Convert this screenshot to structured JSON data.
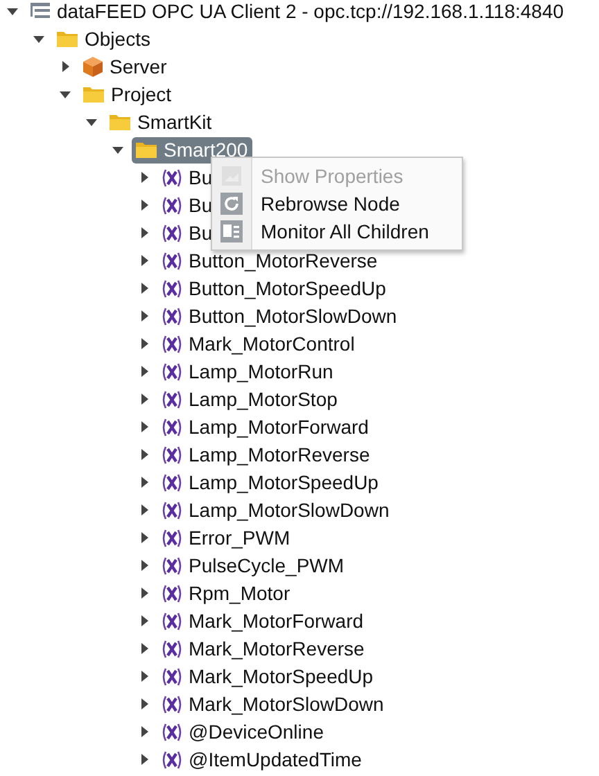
{
  "tree": [
    {
      "label": "dataFEED OPC UA Client 2 - opc.tcp://192.168.1.118:4840",
      "kind": "root",
      "expanded": true,
      "selected": false,
      "children": [
        {
          "label": "Objects",
          "kind": "folder",
          "expanded": true,
          "selected": false,
          "children": [
            {
              "label": "Server",
              "kind": "object",
              "expanded": false,
              "selected": false
            },
            {
              "label": "Project",
              "kind": "folder",
              "expanded": true,
              "selected": false,
              "children": [
                {
                  "label": "SmartKit",
                  "kind": "folder",
                  "expanded": true,
                  "selected": false,
                  "children": [
                    {
                      "label": "Smart200",
                      "kind": "folder",
                      "expanded": true,
                      "selected": true,
                      "children": [
                        {
                          "label": "Bu",
                          "kind": "variable",
                          "expanded": false,
                          "selected": false
                        },
                        {
                          "label": "Bu",
                          "kind": "variable",
                          "expanded": false,
                          "selected": false
                        },
                        {
                          "label": "Bu",
                          "kind": "variable",
                          "expanded": false,
                          "selected": false
                        },
                        {
                          "label": "Button_MotorReverse",
                          "kind": "variable",
                          "expanded": false,
                          "selected": false
                        },
                        {
                          "label": "Button_MotorSpeedUp",
                          "kind": "variable",
                          "expanded": false,
                          "selected": false
                        },
                        {
                          "label": "Button_MotorSlowDown",
                          "kind": "variable",
                          "expanded": false,
                          "selected": false
                        },
                        {
                          "label": "Mark_MotorControl",
                          "kind": "variable",
                          "expanded": false,
                          "selected": false
                        },
                        {
                          "label": "Lamp_MotorRun",
                          "kind": "variable",
                          "expanded": false,
                          "selected": false
                        },
                        {
                          "label": "Lamp_MotorStop",
                          "kind": "variable",
                          "expanded": false,
                          "selected": false
                        },
                        {
                          "label": "Lamp_MotorForward",
                          "kind": "variable",
                          "expanded": false,
                          "selected": false
                        },
                        {
                          "label": "Lamp_MotorReverse",
                          "kind": "variable",
                          "expanded": false,
                          "selected": false
                        },
                        {
                          "label": "Lamp_MotorSpeedUp",
                          "kind": "variable",
                          "expanded": false,
                          "selected": false
                        },
                        {
                          "label": "Lamp_MotorSlowDown",
                          "kind": "variable",
                          "expanded": false,
                          "selected": false
                        },
                        {
                          "label": "Error_PWM",
                          "kind": "variable",
                          "expanded": false,
                          "selected": false
                        },
                        {
                          "label": "PulseCycle_PWM",
                          "kind": "variable",
                          "expanded": false,
                          "selected": false
                        },
                        {
                          "label": "Rpm_Motor",
                          "kind": "variable",
                          "expanded": false,
                          "selected": false
                        },
                        {
                          "label": "Mark_MotorForward",
                          "kind": "variable",
                          "expanded": false,
                          "selected": false
                        },
                        {
                          "label": "Mark_MotorReverse",
                          "kind": "variable",
                          "expanded": false,
                          "selected": false
                        },
                        {
                          "label": "Mark_MotorSpeedUp",
                          "kind": "variable",
                          "expanded": false,
                          "selected": false
                        },
                        {
                          "label": "Mark_MotorSlowDown",
                          "kind": "variable",
                          "expanded": false,
                          "selected": false
                        },
                        {
                          "label": "@DeviceOnline",
                          "kind": "variable",
                          "expanded": false,
                          "selected": false
                        },
                        {
                          "label": "@ItemUpdatedTime",
                          "kind": "variable",
                          "expanded": false,
                          "selected": false
                        }
                      ]
                    }
                  ]
                }
              ]
            }
          ]
        }
      ]
    }
  ],
  "context_menu": [
    {
      "label": "Show Properties",
      "kind": "properties",
      "disabled": true
    },
    {
      "label": "Rebrowse Node",
      "kind": "refresh",
      "disabled": false
    },
    {
      "label": "Monitor All Children",
      "kind": "monitor",
      "disabled": false
    }
  ]
}
